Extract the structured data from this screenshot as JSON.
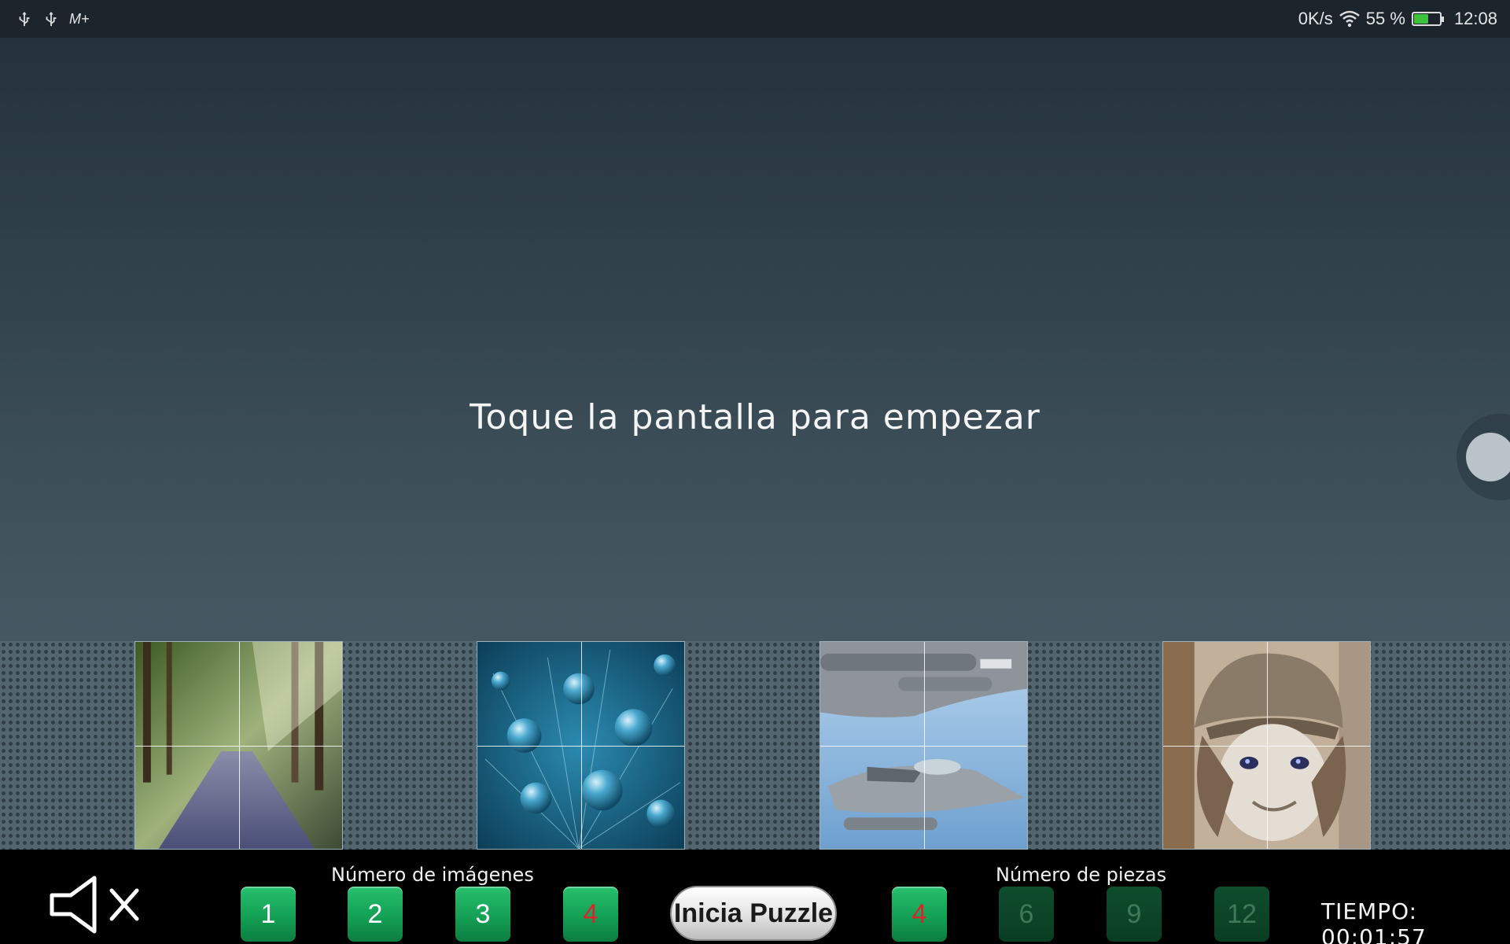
{
  "status_bar": {
    "left_icons": [
      "usb-icon",
      "usb-icon",
      "carrier-icon"
    ],
    "carrier": "M+",
    "net_speed": "0K/s",
    "battery_percent": "55 %",
    "time": "12:08"
  },
  "main": {
    "prompt": "Toque la pantalla para empezar"
  },
  "gallery": {
    "images": [
      {
        "subject": "forest road with sunbeams"
      },
      {
        "subject": "blue water droplets"
      },
      {
        "subject": "fighter jets in sky"
      },
      {
        "subject": "doll figure with knit hat"
      }
    ],
    "pieces_grid": "2x2"
  },
  "controls": {
    "images_label": "Número de imágenes",
    "image_counts": [
      {
        "label": "1",
        "state": "enabled"
      },
      {
        "label": "2",
        "state": "enabled"
      },
      {
        "label": "3",
        "state": "enabled"
      },
      {
        "label": "4",
        "state": "selected"
      }
    ],
    "start_label": "Inicia Puzzle",
    "pieces_label": "Número de piezas",
    "piece_counts": [
      {
        "label": "4",
        "state": "selected"
      },
      {
        "label": "6",
        "state": "disabled"
      },
      {
        "label": "9",
        "state": "disabled"
      },
      {
        "label": "12",
        "state": "disabled"
      }
    ],
    "timer": "TIEMPO: 00:01:57",
    "mute_icon": "speaker-muted-icon"
  },
  "colors": {
    "button_green": "#14a055",
    "selected_number": "#d8262c",
    "button_dim": "#0f4d2d"
  }
}
